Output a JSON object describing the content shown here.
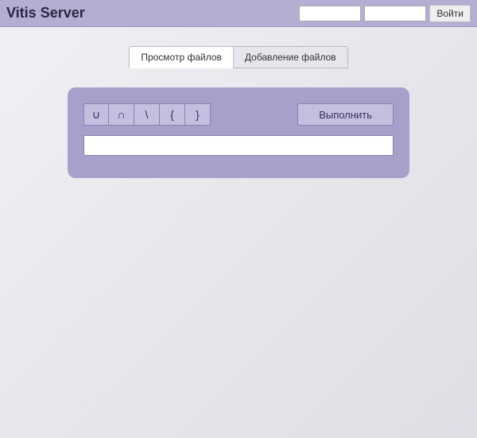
{
  "header": {
    "title": "Vitis Server",
    "username_value": "",
    "password_value": "",
    "login_label": "Войти"
  },
  "tabs": {
    "view_label": "Просмотр файлов",
    "add_label": "Добавление файлов"
  },
  "panel": {
    "symbols": {
      "s0": "∪",
      "s1": "∩",
      "s2": "\\",
      "s3": "{",
      "s4": "}"
    },
    "execute_label": "Выполнить",
    "query_value": ""
  }
}
